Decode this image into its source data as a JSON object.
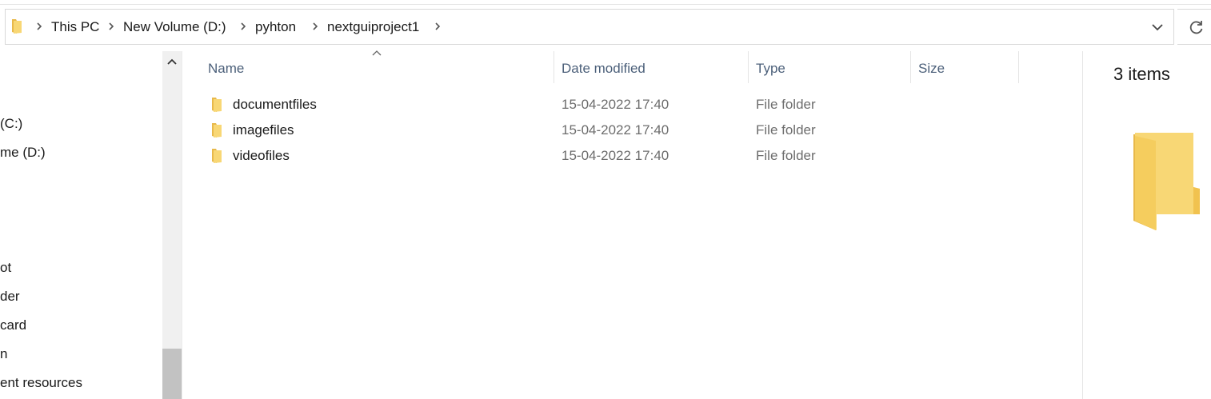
{
  "address_bar": {
    "breadcrumbs": [
      "This PC",
      "New Volume (D:)",
      "pyhton",
      "nextguiproject1"
    ],
    "icons": [
      "folder-icon",
      "chevron-right-icon",
      "chevron-down-icon",
      "refresh-icon"
    ]
  },
  "nav_pane": {
    "items": [
      " (C:)",
      "me (D:)",
      "ot",
      "der",
      " card",
      "n",
      "ent resources"
    ]
  },
  "file_list": {
    "columns": [
      "Name",
      "Date modified",
      "Type",
      "Size"
    ],
    "sorted_by": "Name",
    "rows": [
      {
        "name": "documentfiles",
        "date": "15-04-2022 17:40",
        "type": "File folder",
        "size": ""
      },
      {
        "name": "imagefiles",
        "date": "15-04-2022 17:40",
        "type": "File folder",
        "size": ""
      },
      {
        "name": "videofiles",
        "date": "15-04-2022 17:40",
        "type": "File folder",
        "size": ""
      }
    ]
  },
  "preview": {
    "count_text": "3 items"
  },
  "colors": {
    "folder_yellow": "#f8d775",
    "folder_dark": "#e8b94b",
    "header_text": "#4c607a",
    "muted_text": "#6d6d6d"
  }
}
